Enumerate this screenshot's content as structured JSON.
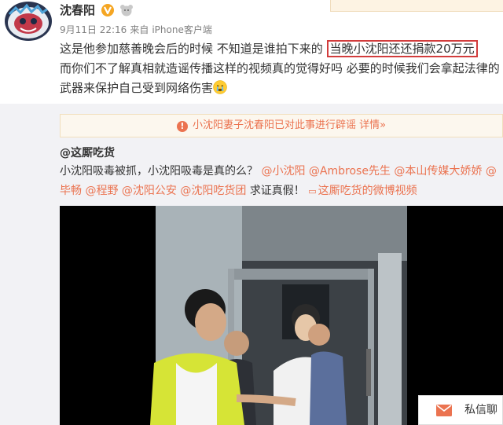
{
  "post": {
    "author": "沈春阳",
    "date": "9月11日 22:16",
    "from_label": "来自",
    "source": "iPhone客户端",
    "text_before": "这是他参加慈善晚会后的时候 不知道是谁拍下来的 ",
    "text_highlight": "当晚小沈阳还还捐款20万元",
    "text_after": "而你们不了解真相就造谣传播这样的视频真的觉得好吗 必要的时候我们会拿起法律的武器来保护自己受到网络伤害"
  },
  "rumor_notice": {
    "text": "小沈阳妻子沈春阳已对此事进行辟谣",
    "link": "详情»"
  },
  "repost": {
    "author": "@这厮吃货",
    "text_start": "小沈阳吸毒被抓，小沈阳吸毒是真的么？",
    "mentions": [
      "@小沈阳",
      "@Ambrose先生",
      "@本山传媒大娇娇",
      "@毕畅",
      "@程野",
      "@沈阳公安",
      "@沈阳吃货团"
    ],
    "text_end": "求证真假！",
    "video_link": "这厮吃货的微博视频"
  },
  "dm": {
    "label": "私信聊"
  },
  "colors": {
    "accent": "#eb7350",
    "highlight_box": "#d23c3c",
    "repost_bg": "#f2f2f5"
  }
}
